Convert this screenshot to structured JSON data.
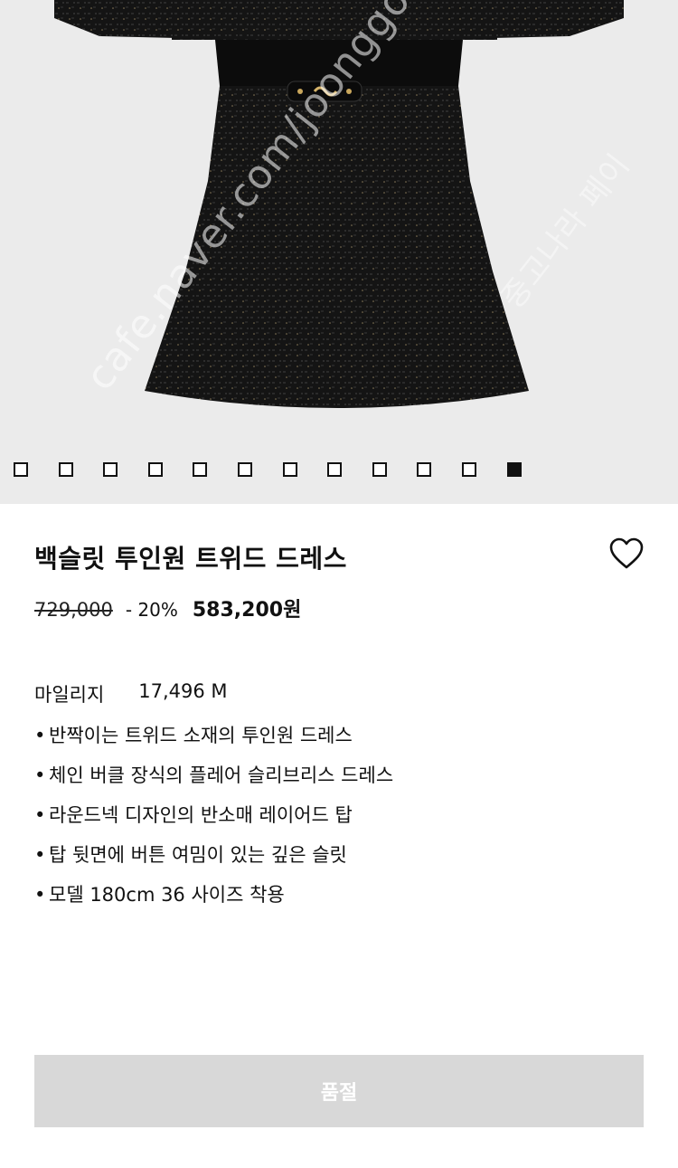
{
  "product": {
    "title": "백슬릿 투인원 트위드 드레스",
    "original_price": "729,000",
    "discount": "- 20%",
    "final_price": "583,200원"
  },
  "gallery": {
    "total_images": 12,
    "active_index": 12,
    "watermark_main": "cafe.naver.com/joonggonara",
    "watermark_side": "중고나라 페이"
  },
  "mileage": {
    "label": "마일리지",
    "value": "17,496 M"
  },
  "features": [
    "반짝이는 트위드 소재의 투인원 드레스",
    "체인 버클 장식의 플레어 슬리브리스 드레스",
    "라운드넥 디자인의 반소매 레이어드 탑",
    "탑 뒷면에 버튼 여밈이 있는 깊은 슬릿",
    "모델 180cm 36 사이즈 착용"
  ],
  "bullet_glyph": "•",
  "actions": {
    "soldout_label": "품절"
  },
  "icons": {
    "wishlist": "heart-outline-icon"
  },
  "colors": {
    "hero_bg": "#ebebeb",
    "soldout_bg": "#d8d8d8",
    "text": "#111111"
  }
}
